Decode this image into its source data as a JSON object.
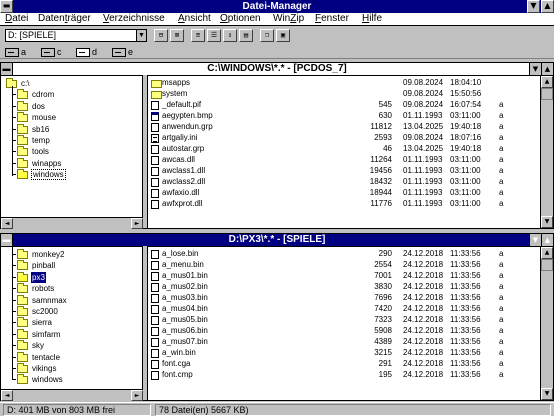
{
  "window": {
    "title": "Datei-Manager",
    "minimize": "▼",
    "maximize": "▲"
  },
  "menu": [
    {
      "pre": "",
      "key": "D",
      "post": "atei"
    },
    {
      "pre": "Daten",
      "key": "t",
      "post": "räger"
    },
    {
      "pre": "",
      "key": "V",
      "post": "erzeichnisse"
    },
    {
      "pre": "",
      "key": "A",
      "post": "nsicht"
    },
    {
      "pre": "",
      "key": "O",
      "post": "ptionen"
    },
    {
      "pre": "Win",
      "key": "Z",
      "post": "ip"
    },
    {
      "pre": "",
      "key": "F",
      "post": "enster"
    },
    {
      "pre": "",
      "key": "H",
      "post": "ilfe"
    }
  ],
  "toolbar": {
    "drive_value": "D: [SPIELE]"
  },
  "drives": [
    {
      "letter": "a",
      "selected": false
    },
    {
      "letter": "c",
      "selected": false
    },
    {
      "letter": "d",
      "selected": true
    },
    {
      "letter": "e",
      "selected": false
    }
  ],
  "top_panel": {
    "title": "C:\\WINDOWS\\*.* - [PCDOS_7]",
    "tree": [
      {
        "label": "c:\\",
        "level": 0
      },
      {
        "label": "cdrom",
        "level": 1
      },
      {
        "label": "dos",
        "level": 1
      },
      {
        "label": "mouse",
        "level": 1
      },
      {
        "label": "sb16",
        "level": 1
      },
      {
        "label": "temp",
        "level": 1
      },
      {
        "label": "tools",
        "level": 1
      },
      {
        "label": "winapps",
        "level": 1
      },
      {
        "label": "windows",
        "level": 1,
        "open": true,
        "focus": true
      }
    ],
    "files": [
      {
        "icon": "folder",
        "name": "msapps",
        "size": "",
        "date": "09.08.2024",
        "time": "18:04:10",
        "attr": ""
      },
      {
        "icon": "folder",
        "name": "system",
        "size": "",
        "date": "09.08.2024",
        "time": "15:50:56",
        "attr": ""
      },
      {
        "icon": "doc",
        "name": "_default.pif",
        "size": "545",
        "date": "09.08.2024",
        "time": "16:07:54",
        "attr": "a"
      },
      {
        "icon": "exe",
        "name": "aegypten.bmp",
        "size": "630",
        "date": "01.11.1993",
        "time": "03:11:00",
        "attr": "a"
      },
      {
        "icon": "doc",
        "name": "anwendun.grp",
        "size": "11812",
        "date": "13.04.2025",
        "time": "19:40:18",
        "attr": "a"
      },
      {
        "icon": "txt",
        "name": "artgaliy.ini",
        "size": "2593",
        "date": "09.08.2024",
        "time": "18:07:16",
        "attr": "a"
      },
      {
        "icon": "doc",
        "name": "autostar.grp",
        "size": "46",
        "date": "13.04.2025",
        "time": "19:40:18",
        "attr": "a"
      },
      {
        "icon": "doc",
        "name": "awcas.dll",
        "size": "11264",
        "date": "01.11.1993",
        "time": "03:11:00",
        "attr": "a"
      },
      {
        "icon": "doc",
        "name": "awclass1.dll",
        "size": "19456",
        "date": "01.11.1993",
        "time": "03:11:00",
        "attr": "a"
      },
      {
        "icon": "doc",
        "name": "awclass2.dll",
        "size": "18432",
        "date": "01.11.1993",
        "time": "03:11:00",
        "attr": "a"
      },
      {
        "icon": "doc",
        "name": "awfaxio.dll",
        "size": "18944",
        "date": "01.11.1993",
        "time": "03:11:00",
        "attr": "a"
      },
      {
        "icon": "doc",
        "name": "awfxprot.dll",
        "size": "11776",
        "date": "01.11.1993",
        "time": "03:11:00",
        "attr": "a"
      }
    ]
  },
  "bottom_panel": {
    "title": "D:\\PX3\\*.* - [SPIELE]",
    "tree": [
      {
        "label": "monkey2",
        "level": 1
      },
      {
        "label": "pinball",
        "level": 1
      },
      {
        "label": "px3",
        "level": 1,
        "open": true,
        "selected": true
      },
      {
        "label": "robots",
        "level": 1
      },
      {
        "label": "samnmax",
        "level": 1
      },
      {
        "label": "sc2000",
        "level": 1
      },
      {
        "label": "sierra",
        "level": 1
      },
      {
        "label": "simfarm",
        "level": 1
      },
      {
        "label": "sky",
        "level": 1
      },
      {
        "label": "tentacle",
        "level": 1
      },
      {
        "label": "vikings",
        "level": 1
      },
      {
        "label": "windows",
        "level": 1
      }
    ],
    "files": [
      {
        "icon": "doc",
        "name": "a_lose.bin",
        "size": "290",
        "date": "24.12.2018",
        "time": "11:33:56",
        "attr": "a"
      },
      {
        "icon": "doc",
        "name": "a_menu.bin",
        "size": "2554",
        "date": "24.12.2018",
        "time": "11:33:56",
        "attr": "a"
      },
      {
        "icon": "doc",
        "name": "a_mus01.bin",
        "size": "7001",
        "date": "24.12.2018",
        "time": "11:33:56",
        "attr": "a"
      },
      {
        "icon": "doc",
        "name": "a_mus02.bin",
        "size": "3830",
        "date": "24.12.2018",
        "time": "11:33:56",
        "attr": "a"
      },
      {
        "icon": "doc",
        "name": "a_mus03.bin",
        "size": "7696",
        "date": "24.12.2018",
        "time": "11:33:56",
        "attr": "a"
      },
      {
        "icon": "doc",
        "name": "a_mus04.bin",
        "size": "7420",
        "date": "24.12.2018",
        "time": "11:33:56",
        "attr": "a"
      },
      {
        "icon": "doc",
        "name": "a_mus05.bin",
        "size": "7323",
        "date": "24.12.2018",
        "time": "11:33:56",
        "attr": "a"
      },
      {
        "icon": "doc",
        "name": "a_mus06.bin",
        "size": "5908",
        "date": "24.12.2018",
        "time": "11:33:56",
        "attr": "a"
      },
      {
        "icon": "doc",
        "name": "a_mus07.bin",
        "size": "4389",
        "date": "24.12.2018",
        "time": "11:33:56",
        "attr": "a"
      },
      {
        "icon": "doc",
        "name": "a_win.bin",
        "size": "3215",
        "date": "24.12.2018",
        "time": "11:33:56",
        "attr": "a"
      },
      {
        "icon": "doc",
        "name": "font.cga",
        "size": "291",
        "date": "24.12.2018",
        "time": "11:33:56",
        "attr": "a"
      },
      {
        "icon": "doc",
        "name": "font.cmp",
        "size": "195",
        "date": "24.12.2018",
        "time": "11:33:56",
        "attr": "a"
      }
    ]
  },
  "status": {
    "left": "D: 401 MB von 803 MB frei",
    "right": "78 Datei(en) 5667 KB)"
  },
  "colors": {
    "titlebar": "#000080",
    "panel_bg": "#c0c0c0",
    "folder": "#ffff80"
  }
}
